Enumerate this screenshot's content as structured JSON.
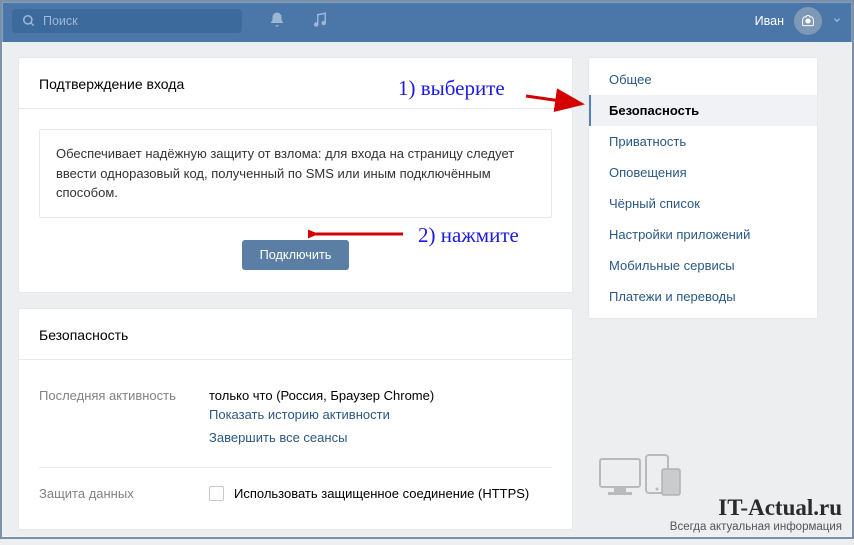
{
  "topbar": {
    "search_placeholder": "Поиск",
    "username": "Иван"
  },
  "panel1": {
    "title": "Подтверждение входа",
    "info": "Обеспечивает надёжную защиту от взлома: для входа на страницу следует ввести одноразовый код, полученный по SMS или иным подключённым способом.",
    "button": "Подключить"
  },
  "panel2": {
    "title": "Безопасность",
    "activity_label": "Последняя активность",
    "activity_value": "только что (Россия, Браузер Chrome)",
    "history_link": "Показать историю активности",
    "endall_link": "Завершить все сеансы",
    "data_label": "Защита данных",
    "https_label": "Использовать защищенное соединение (HTTPS)"
  },
  "sidebar": {
    "items": [
      {
        "label": "Общее"
      },
      {
        "label": "Безопасность"
      },
      {
        "label": "Приватность"
      },
      {
        "label": "Оповещения"
      },
      {
        "label": "Чёрный список"
      },
      {
        "label": "Настройки приложений"
      },
      {
        "label": "Мобильные сервисы"
      },
      {
        "label": "Платежи и переводы"
      }
    ],
    "active_index": 1
  },
  "annotations": {
    "step1": "1) выберите",
    "step2": "2) нажмите"
  },
  "watermark": {
    "title": "IT-Actual.ru",
    "subtitle": "Всегда актуальная информация"
  }
}
